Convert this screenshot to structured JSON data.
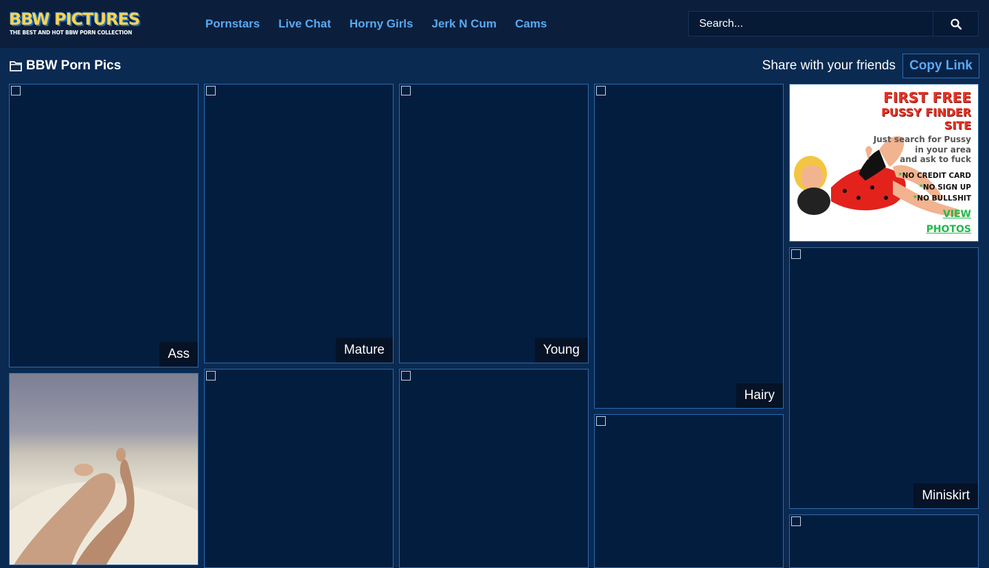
{
  "header": {
    "logo_text": "BBW PICTURES",
    "logo_tagline": "THE BEST AND HOT BBW PORN COLLECTION",
    "nav": [
      {
        "label": "Pornstars"
      },
      {
        "label": "Live Chat"
      },
      {
        "label": "Horny Girls"
      },
      {
        "label": "Jerk N Cum"
      },
      {
        "label": "Cams"
      }
    ],
    "search": {
      "placeholder": "Search...",
      "button_icon": "search-icon"
    }
  },
  "page": {
    "title": "BBW Porn Pics",
    "title_icon": "folder-icon",
    "share_text": "Share with your friends",
    "copy_link_label": "Copy Link"
  },
  "gallery": {
    "tiles": [
      {
        "label": "Ass"
      },
      {
        "label": "Mature"
      },
      {
        "label": "Young"
      },
      {
        "label": "Hairy"
      },
      {
        "label": "Miniskirt"
      }
    ]
  },
  "ad": {
    "headline1": "FIRST FREE",
    "headline2a": "PUSSY FINDER",
    "headline2b": "SITE",
    "body1": "Just search for Pussy",
    "body2": "in your area",
    "body3": "and ask to fuck",
    "bullet1": "NO CREDIT CARD",
    "bullet2": "NO SIGN UP",
    "bullet3": "NO BULLSHIT",
    "cta1": "VIEW",
    "cta2": "PHOTOS"
  },
  "colors": {
    "header_bg": "#0b1f3d",
    "page_bg": "#0a2a52",
    "link": "#5aa9f0",
    "tile_bg": "#031d3f",
    "tile_border": "#2d6cb0"
  }
}
